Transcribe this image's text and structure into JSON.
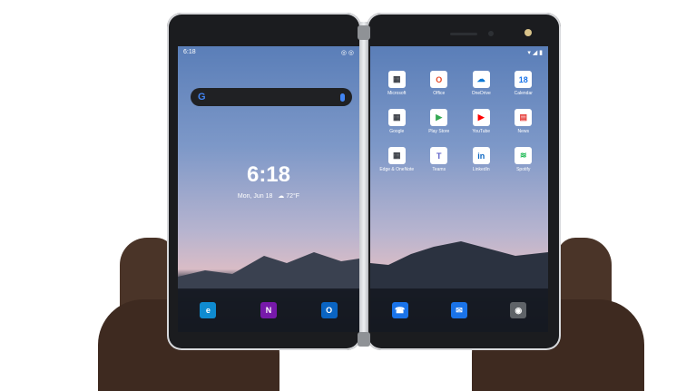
{
  "status_left": {
    "time": "6:18",
    "icons": "◎ ◎"
  },
  "status_right": {
    "icons": "▾ ◢ ▮"
  },
  "search": {
    "logo": "G"
  },
  "clock": {
    "time": "6:18",
    "date": "Mon, Jun 18",
    "weather": "☁ 72°F"
  },
  "apps": [
    {
      "label": "Microsoft",
      "glyph": "▦",
      "color": "#3b3f46"
    },
    {
      "label": "Office",
      "glyph": "O",
      "color": "#e74825"
    },
    {
      "label": "OneDrive",
      "glyph": "☁",
      "color": "#0f78d4"
    },
    {
      "label": "Calendar",
      "glyph": "18",
      "color": "#1a73e8"
    },
    {
      "label": "Google",
      "glyph": "▦",
      "color": "#3b3f46"
    },
    {
      "label": "Play Store",
      "glyph": "▶",
      "color": "#34a853"
    },
    {
      "label": "YouTube",
      "glyph": "▶",
      "color": "#ff0000"
    },
    {
      "label": "News",
      "glyph": "▤",
      "color": "#e53935"
    },
    {
      "label": "Edge & OneNote",
      "glyph": "▦",
      "color": "#3b3f46"
    },
    {
      "label": "Teams",
      "glyph": "T",
      "color": "#5b5fc7"
    },
    {
      "label": "LinkedIn",
      "glyph": "in",
      "color": "#0a66c2"
    },
    {
      "label": "Spotify",
      "glyph": "≋",
      "color": "#1db954"
    }
  ],
  "dock_left": [
    {
      "glyph": "e",
      "color": "#0f8bd0",
      "name": "edge"
    },
    {
      "glyph": "N",
      "color": "#7719aa",
      "name": "onenote"
    },
    {
      "glyph": "O",
      "color": "#0a64c2",
      "name": "outlook"
    }
  ],
  "dock_right": [
    {
      "glyph": "☎",
      "color": "#1a73e8",
      "name": "phone"
    },
    {
      "glyph": "✉",
      "color": "#1a73e8",
      "name": "messages"
    },
    {
      "glyph": "◉",
      "color": "#5f6368",
      "name": "camera"
    }
  ]
}
